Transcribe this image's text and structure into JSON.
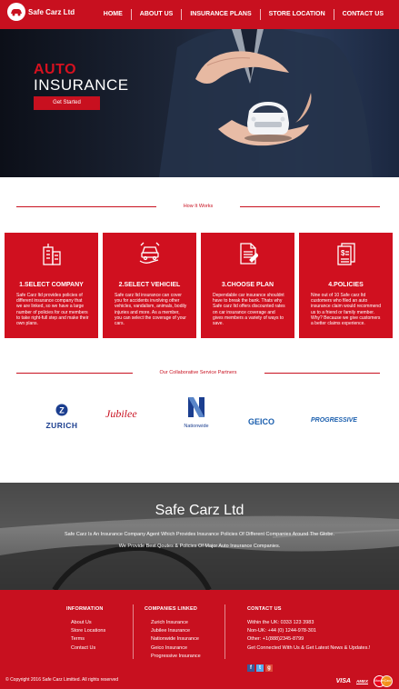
{
  "brand": {
    "name": "Safe Carz Ltd"
  },
  "nav": {
    "links": [
      {
        "label": "HOME"
      },
      {
        "label": "ABOUT US"
      },
      {
        "label": "INSURANCE PLANS"
      },
      {
        "label": "STORE LOCATION"
      },
      {
        "label": "CONTACT US"
      }
    ]
  },
  "hero": {
    "title_line1": "AUTO",
    "title_line2": "INSURANCE",
    "cta": "Get Started"
  },
  "how_it_works": {
    "heading": "How It Works",
    "cards": [
      {
        "icon": "building-icon",
        "title": "1.SELECT COMPANY",
        "text": "Safe Carz ltd provides policies of different insurance company that we are linked, so we have a large number of policies for our members to take right-full step and make their own plans."
      },
      {
        "icon": "car-hand-icon",
        "title": "2.SELECT VEHICIEL",
        "text": "Safe carz ltd insurance can cover you for accidents involving other vehicles, vandalism, animals, bodily injuries and more. As a member, you can select the coverage of your cars."
      },
      {
        "icon": "document-icon",
        "title": "3.CHOOSE PLAN",
        "text": "Dependable car insurance shouldnt have to break the bank. Thats why Safe carz ltd offers discounted rates on car insurance coverage and gives members a variety of ways to save."
      },
      {
        "icon": "policy-icon",
        "title": "4.POLICIES",
        "text": "Nine out of 10 Safe carz ltd customers who filed an auto insurance claim would recommend us to a friend or family member. Why? Because we give customers a better claims experience."
      }
    ]
  },
  "partners": {
    "heading": "Our Collaborative Service Partners",
    "logos": [
      {
        "name": "ZURICH",
        "color": "#1b3e8f"
      },
      {
        "name": "Jubilee",
        "color": "#c8101f"
      },
      {
        "name": "Nationwide",
        "color": "#1b3e8f"
      },
      {
        "name": "GEICO",
        "color": "#1b5fae"
      },
      {
        "name": "PROGRESSIVE",
        "color": "#1b5fae"
      }
    ]
  },
  "banner": {
    "title": "Safe Carz Ltd",
    "line1": "Safe Carz Is An Insurance Company Agent Which Provides Insurance Policies Of Different Companies Around The Globe.",
    "line2": "We Provide Best Qoutes & Policies Of Major Auto Insurance Companies."
  },
  "footer": {
    "information": {
      "heading": "INFORMATION",
      "items": [
        "About Us",
        "Store Locations",
        "Terms",
        "Contact Us"
      ]
    },
    "companies": {
      "heading": "COMPANIES LINKED",
      "items": [
        "Zurich Insurance",
        "Jubilee Insurance",
        "Nationwide Insurance",
        "Geico Insurance",
        "Progressive Insurance"
      ]
    },
    "contact": {
      "heading": "CONTACT US",
      "uk": "Within the UK: 0333 123 3983",
      "non_uk": "Non-UK: +44 (0) 1244-978-301",
      "other": "Other: +1(888)2345-8799",
      "newsletter": "Get Connected With Us & Get Latest News & Updates.!"
    },
    "copyright": "© Copyright 2016 Safe Carz Limitted. All rights reserved",
    "payments": [
      "VISA",
      "AMEX",
      "MasterCard"
    ]
  },
  "colors": {
    "brand_red": "#c8101f",
    "white": "#ffffff"
  }
}
